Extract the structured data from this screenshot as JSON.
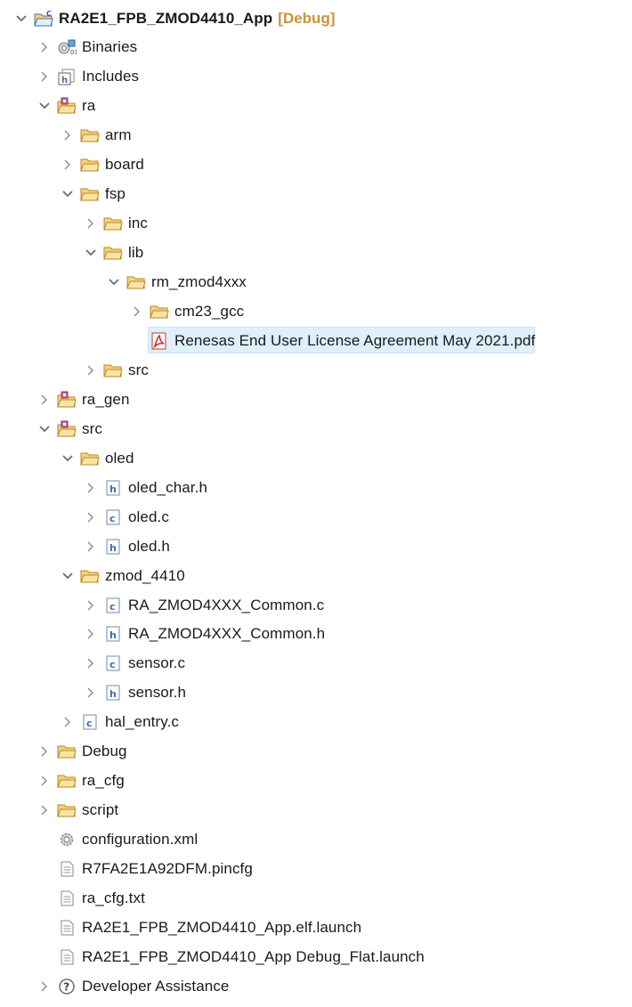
{
  "project": {
    "name": "RA2E1_FPB_ZMOD4410_App",
    "config": "[Debug]"
  },
  "rows": [
    {
      "id": "project-root",
      "label": "RA2E1_FPB_ZMOD4410_App",
      "depth": 0,
      "tw": "expanded",
      "icon": "project-icon",
      "bold": true,
      "suffixKey": "project.config"
    },
    {
      "id": "binaries",
      "label": "Binaries",
      "depth": 1,
      "tw": "collapsed",
      "icon": "binaries-icon"
    },
    {
      "id": "includes",
      "label": "Includes",
      "depth": 1,
      "tw": "collapsed",
      "icon": "includes-icon"
    },
    {
      "id": "ra",
      "label": "ra",
      "depth": 1,
      "tw": "expanded",
      "icon": "source-folder-icon"
    },
    {
      "id": "arm",
      "label": "arm",
      "depth": 2,
      "tw": "collapsed",
      "icon": "folder-icon"
    },
    {
      "id": "board",
      "label": "board",
      "depth": 2,
      "tw": "collapsed",
      "icon": "folder-icon"
    },
    {
      "id": "fsp",
      "label": "fsp",
      "depth": 2,
      "tw": "expanded",
      "icon": "folder-icon"
    },
    {
      "id": "inc",
      "label": "inc",
      "depth": 3,
      "tw": "collapsed",
      "icon": "folder-icon"
    },
    {
      "id": "lib",
      "label": "lib",
      "depth": 3,
      "tw": "expanded",
      "icon": "folder-icon"
    },
    {
      "id": "rm-zmod4xxx",
      "label": "rm_zmod4xxx",
      "depth": 4,
      "tw": "expanded",
      "icon": "folder-icon"
    },
    {
      "id": "cm23-gcc",
      "label": "cm23_gcc",
      "depth": 5,
      "tw": "collapsed",
      "icon": "folder-icon"
    },
    {
      "id": "license-pdf",
      "label": "Renesas End User License Agreement May 2021.pdf",
      "depth": 5,
      "tw": "none",
      "icon": "pdf-icon",
      "selected": true
    },
    {
      "id": "fsp-src",
      "label": "src",
      "depth": 3,
      "tw": "collapsed",
      "icon": "folder-icon"
    },
    {
      "id": "ra-gen",
      "label": "ra_gen",
      "depth": 1,
      "tw": "collapsed",
      "icon": "source-folder-icon"
    },
    {
      "id": "src",
      "label": "src",
      "depth": 1,
      "tw": "expanded",
      "icon": "source-folder-icon"
    },
    {
      "id": "oled",
      "label": "oled",
      "depth": 2,
      "tw": "expanded",
      "icon": "folder-icon"
    },
    {
      "id": "oled-char-h",
      "label": "oled_char.h",
      "depth": 3,
      "tw": "collapsed",
      "icon": "h-file-icon"
    },
    {
      "id": "oled-c",
      "label": "oled.c",
      "depth": 3,
      "tw": "collapsed",
      "icon": "c-file-icon"
    },
    {
      "id": "oled-h",
      "label": "oled.h",
      "depth": 3,
      "tw": "collapsed",
      "icon": "h-file-icon"
    },
    {
      "id": "zmod-4410",
      "label": "zmod_4410",
      "depth": 2,
      "tw": "expanded",
      "icon": "folder-icon"
    },
    {
      "id": "ra-zmod-common-c",
      "label": "RA_ZMOD4XXX_Common.c",
      "depth": 3,
      "tw": "collapsed",
      "icon": "c-file-icon"
    },
    {
      "id": "ra-zmod-common-h",
      "label": "RA_ZMOD4XXX_Common.h",
      "depth": 3,
      "tw": "collapsed",
      "icon": "h-file-icon"
    },
    {
      "id": "sensor-c",
      "label": "sensor.c",
      "depth": 3,
      "tw": "collapsed",
      "icon": "c-file-icon"
    },
    {
      "id": "sensor-h",
      "label": "sensor.h",
      "depth": 3,
      "tw": "collapsed",
      "icon": "h-file-icon"
    },
    {
      "id": "hal-entry-c",
      "label": "hal_entry.c",
      "depth": 2,
      "tw": "collapsed",
      "icon": "c-file-icon"
    },
    {
      "id": "debug",
      "label": "Debug",
      "depth": 1,
      "tw": "collapsed",
      "icon": "folder-icon"
    },
    {
      "id": "ra-cfg",
      "label": "ra_cfg",
      "depth": 1,
      "tw": "collapsed",
      "icon": "folder-icon"
    },
    {
      "id": "script",
      "label": "script",
      "depth": 1,
      "tw": "collapsed",
      "icon": "folder-icon"
    },
    {
      "id": "configuration-xml",
      "label": "configuration.xml",
      "depth": 1,
      "tw": "none",
      "icon": "config-gear-icon"
    },
    {
      "id": "pincfg",
      "label": "R7FA2E1A92DFM.pincfg",
      "depth": 1,
      "tw": "none",
      "icon": "text-file-icon"
    },
    {
      "id": "ra-cfg-txt",
      "label": "ra_cfg.txt",
      "depth": 1,
      "tw": "none",
      "icon": "text-file-icon"
    },
    {
      "id": "elf-launch",
      "label": "RA2E1_FPB_ZMOD4410_App.elf.launch",
      "depth": 1,
      "tw": "none",
      "icon": "text-file-icon"
    },
    {
      "id": "debug-flat-launch",
      "label": "RA2E1_FPB_ZMOD4410_App Debug_Flat.launch",
      "depth": 1,
      "tw": "none",
      "icon": "text-file-icon"
    },
    {
      "id": "developer-assistance",
      "label": "Developer Assistance",
      "depth": 1,
      "tw": "collapsed",
      "icon": "help-icon"
    }
  ],
  "colors": {
    "selection": "#dfeffc",
    "folder": "#e8b04a",
    "config_suffix": "#c8943a"
  }
}
